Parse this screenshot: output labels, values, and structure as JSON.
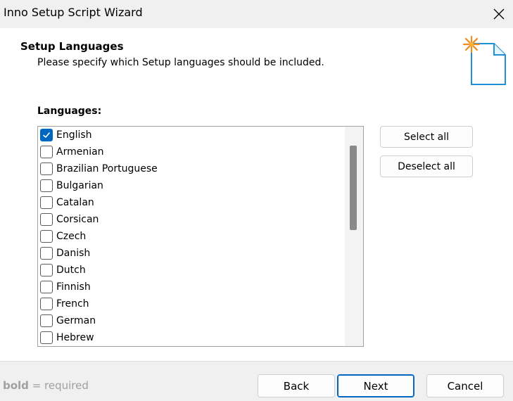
{
  "window": {
    "title": "Inno Setup Script Wizard"
  },
  "header": {
    "title": "Setup Languages",
    "subtitle": "Please specify which Setup languages should be included."
  },
  "languages": {
    "label": "Languages:",
    "items": [
      {
        "label": "English",
        "checked": true
      },
      {
        "label": "Armenian",
        "checked": false
      },
      {
        "label": "Brazilian Portuguese",
        "checked": false
      },
      {
        "label": "Bulgarian",
        "checked": false
      },
      {
        "label": "Catalan",
        "checked": false
      },
      {
        "label": "Corsican",
        "checked": false
      },
      {
        "label": "Czech",
        "checked": false
      },
      {
        "label": "Danish",
        "checked": false
      },
      {
        "label": "Dutch",
        "checked": false
      },
      {
        "label": "Finnish",
        "checked": false
      },
      {
        "label": "French",
        "checked": false
      },
      {
        "label": "German",
        "checked": false
      },
      {
        "label": "Hebrew",
        "checked": false
      }
    ],
    "select_all_label": "Select all",
    "deselect_all_label": "Deselect all"
  },
  "footer": {
    "hint_bold": "bold",
    "hint_rest": " = required",
    "back_label": "Back",
    "next_label": "Next",
    "cancel_label": "Cancel"
  },
  "colors": {
    "accent": "#0067c0",
    "titlebar_bg": "#f0f0f0",
    "hint_text": "#a0a0a0"
  },
  "icons": {
    "close": "close-icon",
    "wizard": "document-star-icon",
    "check": "check-icon"
  }
}
